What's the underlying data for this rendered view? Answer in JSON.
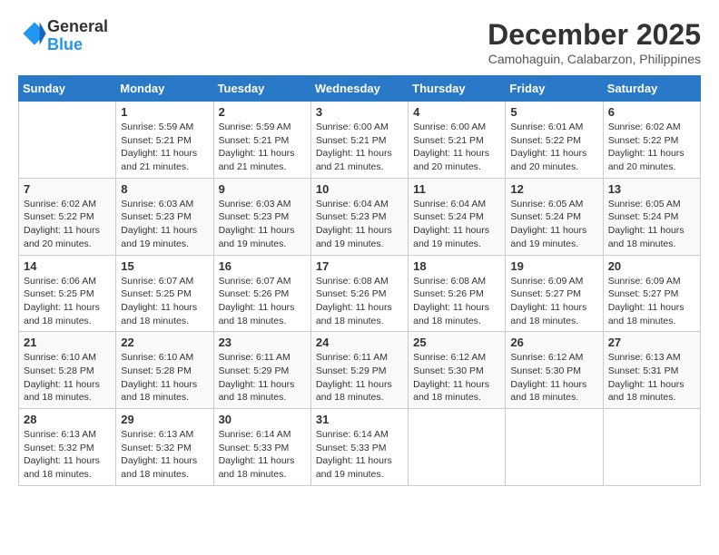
{
  "logo": {
    "general": "General",
    "blue": "Blue"
  },
  "header": {
    "month_year": "December 2025",
    "location": "Camohaguin, Calabarzon, Philippines"
  },
  "weekdays": [
    "Sunday",
    "Monday",
    "Tuesday",
    "Wednesday",
    "Thursday",
    "Friday",
    "Saturday"
  ],
  "weeks": [
    [
      {
        "day": "",
        "info": ""
      },
      {
        "day": "1",
        "info": "Sunrise: 5:59 AM\nSunset: 5:21 PM\nDaylight: 11 hours\nand 21 minutes."
      },
      {
        "day": "2",
        "info": "Sunrise: 5:59 AM\nSunset: 5:21 PM\nDaylight: 11 hours\nand 21 minutes."
      },
      {
        "day": "3",
        "info": "Sunrise: 6:00 AM\nSunset: 5:21 PM\nDaylight: 11 hours\nand 21 minutes."
      },
      {
        "day": "4",
        "info": "Sunrise: 6:00 AM\nSunset: 5:21 PM\nDaylight: 11 hours\nand 20 minutes."
      },
      {
        "day": "5",
        "info": "Sunrise: 6:01 AM\nSunset: 5:22 PM\nDaylight: 11 hours\nand 20 minutes."
      },
      {
        "day": "6",
        "info": "Sunrise: 6:02 AM\nSunset: 5:22 PM\nDaylight: 11 hours\nand 20 minutes."
      }
    ],
    [
      {
        "day": "7",
        "info": "Sunrise: 6:02 AM\nSunset: 5:22 PM\nDaylight: 11 hours\nand 20 minutes."
      },
      {
        "day": "8",
        "info": "Sunrise: 6:03 AM\nSunset: 5:23 PM\nDaylight: 11 hours\nand 19 minutes."
      },
      {
        "day": "9",
        "info": "Sunrise: 6:03 AM\nSunset: 5:23 PM\nDaylight: 11 hours\nand 19 minutes."
      },
      {
        "day": "10",
        "info": "Sunrise: 6:04 AM\nSunset: 5:23 PM\nDaylight: 11 hours\nand 19 minutes."
      },
      {
        "day": "11",
        "info": "Sunrise: 6:04 AM\nSunset: 5:24 PM\nDaylight: 11 hours\nand 19 minutes."
      },
      {
        "day": "12",
        "info": "Sunrise: 6:05 AM\nSunset: 5:24 PM\nDaylight: 11 hours\nand 19 minutes."
      },
      {
        "day": "13",
        "info": "Sunrise: 6:05 AM\nSunset: 5:24 PM\nDaylight: 11 hours\nand 18 minutes."
      }
    ],
    [
      {
        "day": "14",
        "info": "Sunrise: 6:06 AM\nSunset: 5:25 PM\nDaylight: 11 hours\nand 18 minutes."
      },
      {
        "day": "15",
        "info": "Sunrise: 6:07 AM\nSunset: 5:25 PM\nDaylight: 11 hours\nand 18 minutes."
      },
      {
        "day": "16",
        "info": "Sunrise: 6:07 AM\nSunset: 5:26 PM\nDaylight: 11 hours\nand 18 minutes."
      },
      {
        "day": "17",
        "info": "Sunrise: 6:08 AM\nSunset: 5:26 PM\nDaylight: 11 hours\nand 18 minutes."
      },
      {
        "day": "18",
        "info": "Sunrise: 6:08 AM\nSunset: 5:26 PM\nDaylight: 11 hours\nand 18 minutes."
      },
      {
        "day": "19",
        "info": "Sunrise: 6:09 AM\nSunset: 5:27 PM\nDaylight: 11 hours\nand 18 minutes."
      },
      {
        "day": "20",
        "info": "Sunrise: 6:09 AM\nSunset: 5:27 PM\nDaylight: 11 hours\nand 18 minutes."
      }
    ],
    [
      {
        "day": "21",
        "info": "Sunrise: 6:10 AM\nSunset: 5:28 PM\nDaylight: 11 hours\nand 18 minutes."
      },
      {
        "day": "22",
        "info": "Sunrise: 6:10 AM\nSunset: 5:28 PM\nDaylight: 11 hours\nand 18 minutes."
      },
      {
        "day": "23",
        "info": "Sunrise: 6:11 AM\nSunset: 5:29 PM\nDaylight: 11 hours\nand 18 minutes."
      },
      {
        "day": "24",
        "info": "Sunrise: 6:11 AM\nSunset: 5:29 PM\nDaylight: 11 hours\nand 18 minutes."
      },
      {
        "day": "25",
        "info": "Sunrise: 6:12 AM\nSunset: 5:30 PM\nDaylight: 11 hours\nand 18 minutes."
      },
      {
        "day": "26",
        "info": "Sunrise: 6:12 AM\nSunset: 5:30 PM\nDaylight: 11 hours\nand 18 minutes."
      },
      {
        "day": "27",
        "info": "Sunrise: 6:13 AM\nSunset: 5:31 PM\nDaylight: 11 hours\nand 18 minutes."
      }
    ],
    [
      {
        "day": "28",
        "info": "Sunrise: 6:13 AM\nSunset: 5:32 PM\nDaylight: 11 hours\nand 18 minutes."
      },
      {
        "day": "29",
        "info": "Sunrise: 6:13 AM\nSunset: 5:32 PM\nDaylight: 11 hours\nand 18 minutes."
      },
      {
        "day": "30",
        "info": "Sunrise: 6:14 AM\nSunset: 5:33 PM\nDaylight: 11 hours\nand 18 minutes."
      },
      {
        "day": "31",
        "info": "Sunrise: 6:14 AM\nSunset: 5:33 PM\nDaylight: 11 hours\nand 19 minutes."
      },
      {
        "day": "",
        "info": ""
      },
      {
        "day": "",
        "info": ""
      },
      {
        "day": "",
        "info": ""
      }
    ]
  ]
}
